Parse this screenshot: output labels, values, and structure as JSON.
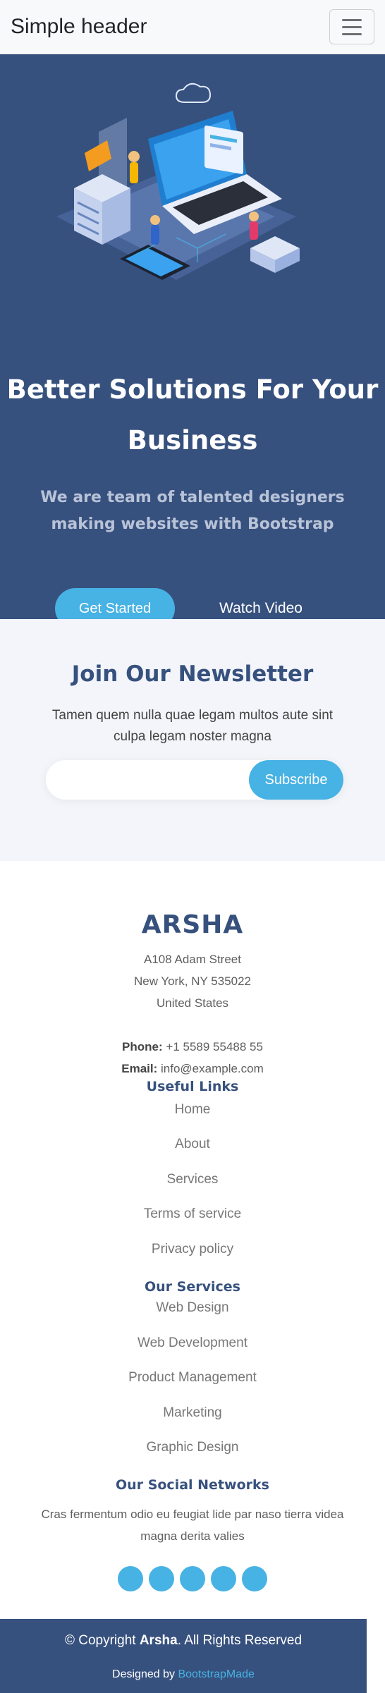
{
  "navbar": {
    "brand": "Simple header"
  },
  "hero": {
    "title_line1": "Better Solutions For Your",
    "title_line2": "Business",
    "subtitle": "We are team of talented designers making websites with Bootstrap",
    "primary_button": "Get Started",
    "secondary_button": "Watch Video"
  },
  "newsletter": {
    "title": "Join Our Newsletter",
    "text": "Tamen quem nulla quae legam multos aute sint culpa legam noster magna",
    "input_value": "",
    "button": "Subscribe"
  },
  "footer": {
    "logo": "ARSHA",
    "address_line1": "A108 Adam Street",
    "address_line2": "New York, NY 535022",
    "address_line3": "United States",
    "phone_label": "Phone:",
    "phone": "+1 5589 55488 55",
    "email_label": "Email:",
    "email": "info@example.com",
    "useful_links_title": "Useful Links",
    "useful_links": [
      "Home",
      "About",
      "Services",
      "Terms of service",
      "Privacy policy"
    ],
    "services_title": "Our Services",
    "services": [
      "Web Design",
      "Web Development",
      "Product Management",
      "Marketing",
      "Graphic Design"
    ],
    "social_title": "Our Social Networks",
    "social_text": "Cras fermentum odio eu feugiat lide par naso tierra videa magna derita valies"
  },
  "bottom": {
    "copyright_prefix": "© Copyright ",
    "copyright_brand": "Arsha",
    "copyright_suffix": ". All Rights Reserved",
    "designed_by": "Designed by ",
    "designer": "BootstrapMade"
  },
  "colors": {
    "primary": "#37517e",
    "accent": "#47b2e4",
    "light_bg": "#f3f5fa"
  }
}
